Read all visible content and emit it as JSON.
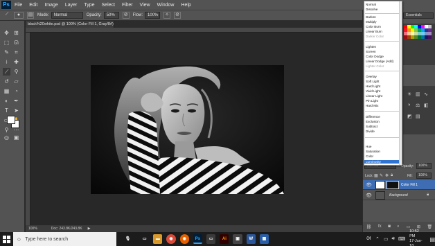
{
  "app": {
    "logo": "Ps"
  },
  "menu": [
    "File",
    "Edit",
    "Image",
    "Layer",
    "Type",
    "Select",
    "Filter",
    "View",
    "Window",
    "Help"
  ],
  "options": {
    "mode_label": "Mode:",
    "mode_value": "Normal",
    "opacity_label": "Opacity:",
    "opacity_value": "50%",
    "flow_label": "Flow:",
    "flow_value": "100%"
  },
  "document_tab": "black%20white.psd @ 100% (Color Fill 1, Gray/8#) ×",
  "status": {
    "zoom": "100%",
    "doc": "Doc: 243.8K/243.8K"
  },
  "blend_modes": {
    "group1": [
      "Normal",
      "Dissolve"
    ],
    "group2": [
      "Darken",
      "Multiply",
      "Color Burn",
      "Linear Burn",
      "Darker Color"
    ],
    "group3": [
      "Lighten",
      "Screen",
      "Color Dodge",
      "Linear Dodge (Add)",
      "Lighter Color"
    ],
    "group4": [
      "Overlay",
      "Soft Light",
      "Hard Light",
      "Vivid Light",
      "Linear Light",
      "Pin Light",
      "Hard Mix"
    ],
    "group5": [
      "Difference",
      "Exclusion",
      "Subtract",
      "Divide"
    ],
    "group6": [
      "Hue",
      "Saturation",
      "Color",
      "Luminosity"
    ]
  },
  "top_right": {
    "workspace": "Essentials"
  },
  "layers_panel": {
    "blend_value": "Normal",
    "opacity_label": "Opacity:",
    "opacity_value": "100%",
    "lock_label": "Lock:",
    "fill_label": "Fill:",
    "fill_value": "100%",
    "layers": [
      "Color Fill 1",
      "Background"
    ]
  },
  "taskbar": {
    "search_placeholder": "Type here to search",
    "time": "10:52 PM",
    "date": "17-Jun-18"
  },
  "colors": {
    "accent": "#31a8ff",
    "selection": "#3e6db3",
    "highlight": "#2f74d0"
  }
}
